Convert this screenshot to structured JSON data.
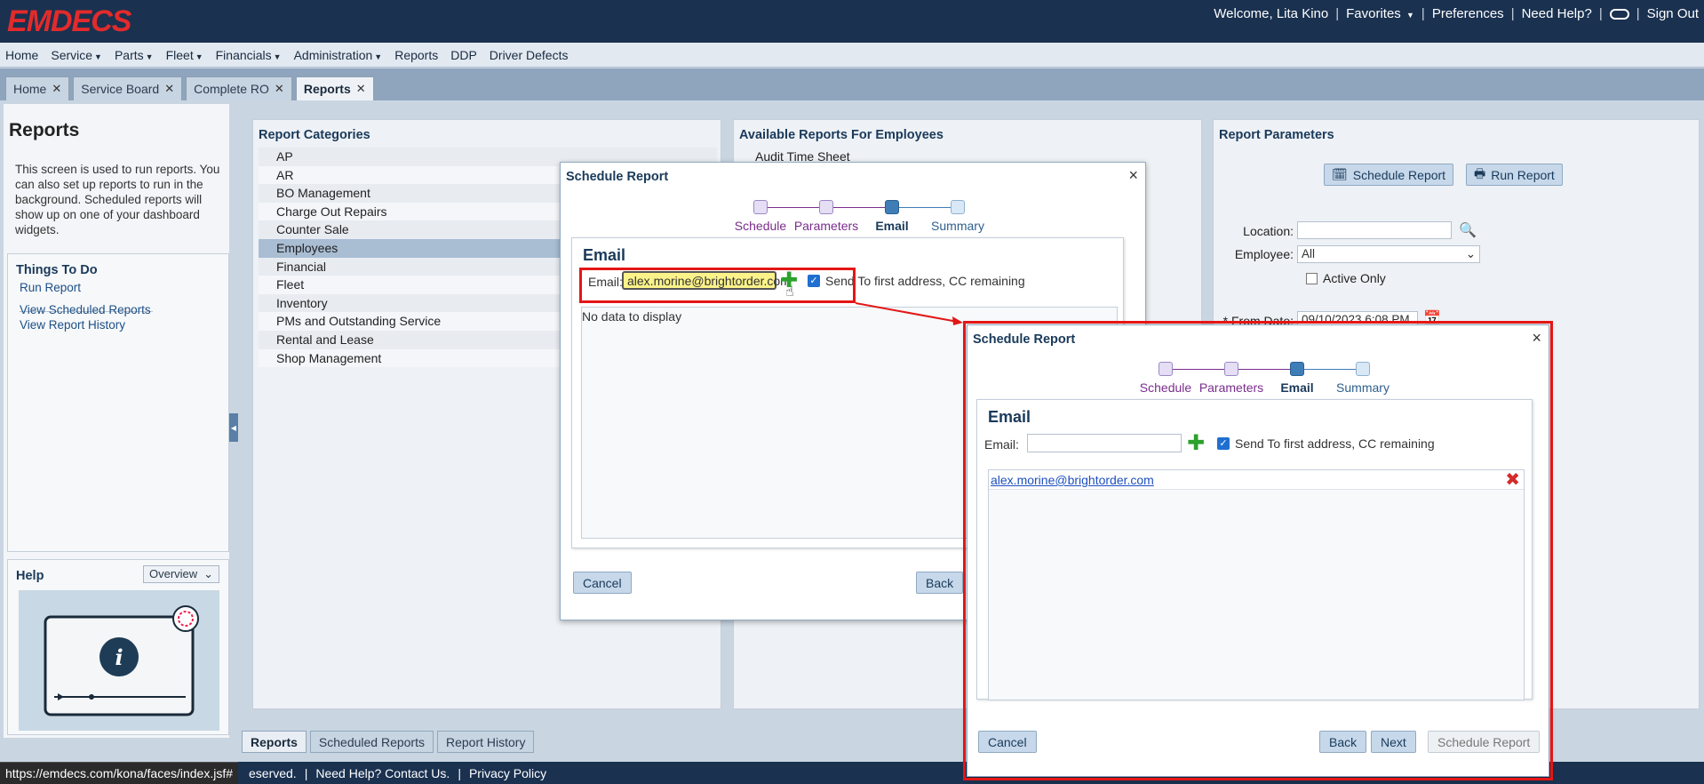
{
  "header": {
    "logo": "EMDECS",
    "welcome": "Welcome, Lita Kino",
    "favorites": "Favorites",
    "preferences": "Preferences",
    "need_help": "Need Help?",
    "sign_out": "Sign Out"
  },
  "menu": [
    "Home",
    "Service",
    "Parts",
    "Fleet",
    "Financials",
    "Administration",
    "Reports",
    "DDP",
    "Driver Defects"
  ],
  "menu_dropdown": [
    false,
    true,
    true,
    true,
    true,
    true,
    false,
    false,
    false
  ],
  "tabs": [
    {
      "label": "Home"
    },
    {
      "label": "Service Board"
    },
    {
      "label": "Complete RO"
    },
    {
      "label": "Reports"
    }
  ],
  "left": {
    "title": "Reports",
    "description": "This screen is used to run reports. You can also set up reports to run in the background. Scheduled reports will show up on one of your dashboard widgets.",
    "things_title": "Things To Do",
    "run_report": "Run Report",
    "view_scheduled": "View Scheduled Reports",
    "view_history": "View Report History",
    "help_title": "Help",
    "help_select": "Overview"
  },
  "categories": {
    "title": "Report Categories",
    "items": [
      "AP",
      "AR",
      "BO Management",
      "Charge Out Repairs",
      "Counter Sale",
      "Employees",
      "Financial",
      "Fleet",
      "Inventory",
      "PMs and Outstanding Service",
      "Rental and Lease",
      "Shop Management"
    ],
    "selected": "Employees"
  },
  "available": {
    "title": "Available Reports For Employees",
    "first": "Audit Time Sheet"
  },
  "params": {
    "title": "Report Parameters",
    "schedule_btn": "Schedule Report",
    "run_btn": "Run Report",
    "location_label": "Location:",
    "employee_label": "Employee:",
    "employee_value": "All",
    "active_only": "Active Only",
    "from_date_label": "* From Date:",
    "from_date_value": "09/10/2023 6:08 PM"
  },
  "bottom_tabs": [
    "Reports",
    "Scheduled Reports",
    "Report History"
  ],
  "footer": {
    "reserved": "eserved.",
    "contact": "Need Help? Contact Us.",
    "privacy": "Privacy Policy",
    "status_url": "https://emdecs.com/kona/faces/index.jsf#"
  },
  "dialog1": {
    "title": "Schedule Report",
    "steps": [
      "Schedule",
      "Parameters",
      "Email",
      "Summary"
    ],
    "section": "Email",
    "email_label": "Email:",
    "email_value": "alex.morine@brightorder.com",
    "send_first": "Send To first address, CC remaining",
    "empty": "No data to display",
    "cancel": "Cancel",
    "back": "Back"
  },
  "dialog2": {
    "title": "Schedule Report",
    "steps": [
      "Schedule",
      "Parameters",
      "Email",
      "Summary"
    ],
    "section": "Email",
    "email_label": "Email:",
    "email_value": "",
    "send_first": "Send To first address, CC remaining",
    "entries": [
      "alex.morine@brightorder.com"
    ],
    "cancel": "Cancel",
    "back": "Back",
    "next": "Next",
    "schedule": "Schedule Report"
  },
  "colors": {
    "header_bg": "#1a3150",
    "logo": "#e22b2b",
    "highlight": "#e41616",
    "input_highlight": "#fbf28a",
    "link": "#1d4f86"
  },
  "icons": {
    "search": "magnifier-icon",
    "add": "plus-icon",
    "remove": "red-x-icon",
    "calendar": "calendar-icon"
  }
}
